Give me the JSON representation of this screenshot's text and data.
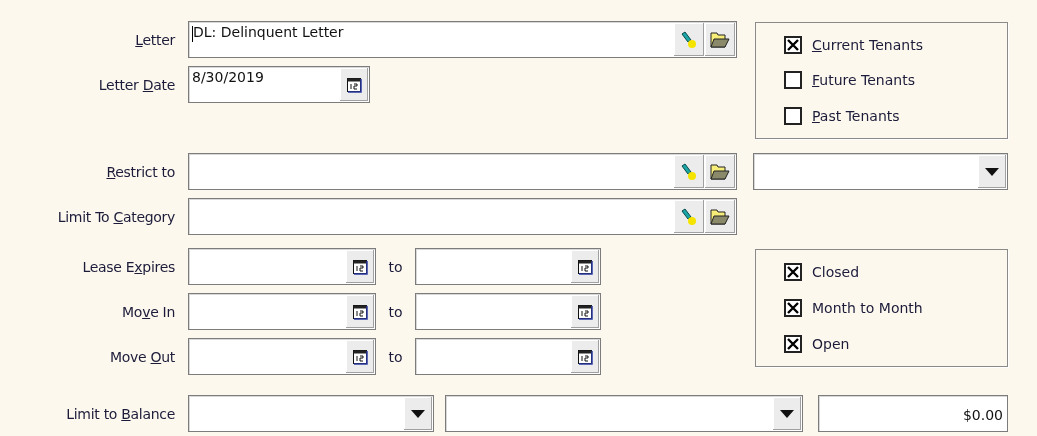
{
  "rows": [
    {
      "kind": "lookup",
      "label": {
        "key": "L",
        "post": "etter"
      },
      "value": "DL: Delinquent Letter",
      "focused": true
    },
    {
      "kind": "date",
      "label": {
        "pre": "Letter ",
        "key": "D",
        "post": "ate"
      },
      "value": "8/30/2019"
    },
    {
      "kind": "lookup",
      "label": {
        "key": "R",
        "post": "estrict to"
      },
      "side_select": true
    },
    {
      "kind": "lookup",
      "label": {
        "pre": "Limit To ",
        "key": "C",
        "post": "ategory"
      }
    },
    {
      "kind": "date_range",
      "label": {
        "pre": "Lease E",
        "key": "x",
        "post": "pires"
      },
      "separator": "to"
    },
    {
      "kind": "date_range",
      "label": {
        "pre": "Mo",
        "key": "v",
        "post": "e In"
      },
      "separator": "to"
    },
    {
      "kind": "date_range",
      "label": {
        "pre": "Move ",
        "key": "O",
        "post": "ut"
      },
      "separator": "to"
    },
    {
      "kind": "balance",
      "label": {
        "pre": "Limit to ",
        "key": "B",
        "post": "alance"
      },
      "amount": "$0.00"
    }
  ],
  "tenant_filters": [
    {
      "label": {
        "key": "C",
        "post": "urrent Tenants"
      },
      "checked": true
    },
    {
      "label": {
        "key": "F",
        "post": "uture Tenants"
      },
      "checked": false
    },
    {
      "label": {
        "key": "P",
        "post": "ast Tenants"
      },
      "checked": false
    }
  ],
  "lease_types": [
    {
      "label": {
        "pre": "Closed"
      },
      "checked": true
    },
    {
      "label": {
        "pre": "Month to Month"
      },
      "checked": true
    },
    {
      "label": {
        "pre": "Open"
      },
      "checked": true
    }
  ]
}
